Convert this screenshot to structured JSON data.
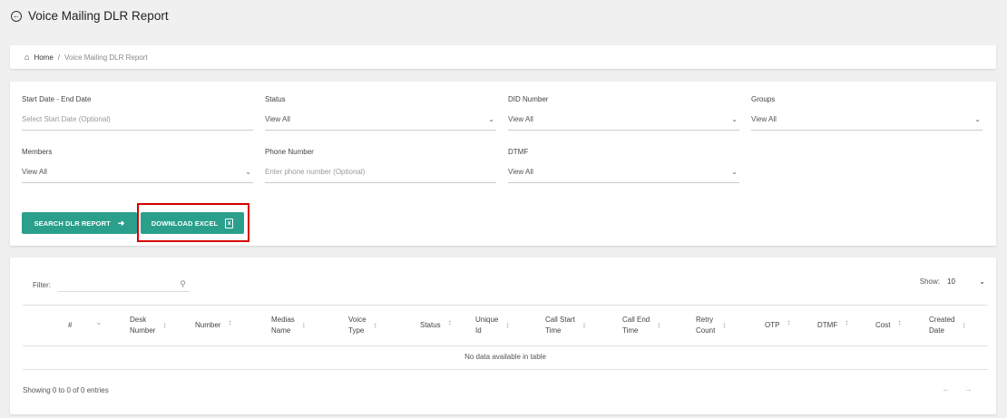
{
  "header": {
    "title": "Voice Mailing DLR Report"
  },
  "breadcrumb": {
    "home": "Home",
    "separator": "/",
    "current": "Voice Mailing DLR Report"
  },
  "filters": {
    "date_range": {
      "label": "Start Date - End Date",
      "placeholder": "Select Start Date (Optional)"
    },
    "status": {
      "label": "Status",
      "value": "View All"
    },
    "did_number": {
      "label": "DID Number",
      "value": "View All"
    },
    "groups": {
      "label": "Groups",
      "value": "View All"
    },
    "members": {
      "label": "Members",
      "value": "View All"
    },
    "phone_number": {
      "label": "Phone Number",
      "placeholder": "Enter phone number (Optional)"
    },
    "dtmf": {
      "label": "DTMF",
      "value": "View All"
    }
  },
  "actions": {
    "search_label": "SEARCH DLR REPORT",
    "download_label": "DOWNLOAD EXCEL",
    "highlight_color": "#d60000",
    "button_color": "#2aa08c"
  },
  "table": {
    "filter_label": "Filter:",
    "show_label": "Show:",
    "show_value": "10",
    "columns": [
      {
        "l1": "#",
        "l2": ""
      },
      {
        "l1": "Desk",
        "l2": "Number"
      },
      {
        "l1": "Number",
        "l2": ""
      },
      {
        "l1": "Medias",
        "l2": "Name"
      },
      {
        "l1": "Voice",
        "l2": "Type"
      },
      {
        "l1": "Status",
        "l2": ""
      },
      {
        "l1": "Unique",
        "l2": "Id"
      },
      {
        "l1": "Call Start",
        "l2": "Time"
      },
      {
        "l1": "Call End",
        "l2": "Time"
      },
      {
        "l1": "Retry",
        "l2": "Count"
      },
      {
        "l1": "OTP",
        "l2": ""
      },
      {
        "l1": "DTMF",
        "l2": ""
      },
      {
        "l1": "Cost",
        "l2": ""
      },
      {
        "l1": "Created",
        "l2": "Date"
      }
    ],
    "empty_message": "No data available in table",
    "info": "Showing 0 to 0 of 0 entries",
    "prev": "←",
    "next": "→"
  },
  "icons": {
    "back": "circle-arrow-left-icon",
    "home": "home-icon",
    "search": "search-icon",
    "excel": "excel-file-icon"
  }
}
